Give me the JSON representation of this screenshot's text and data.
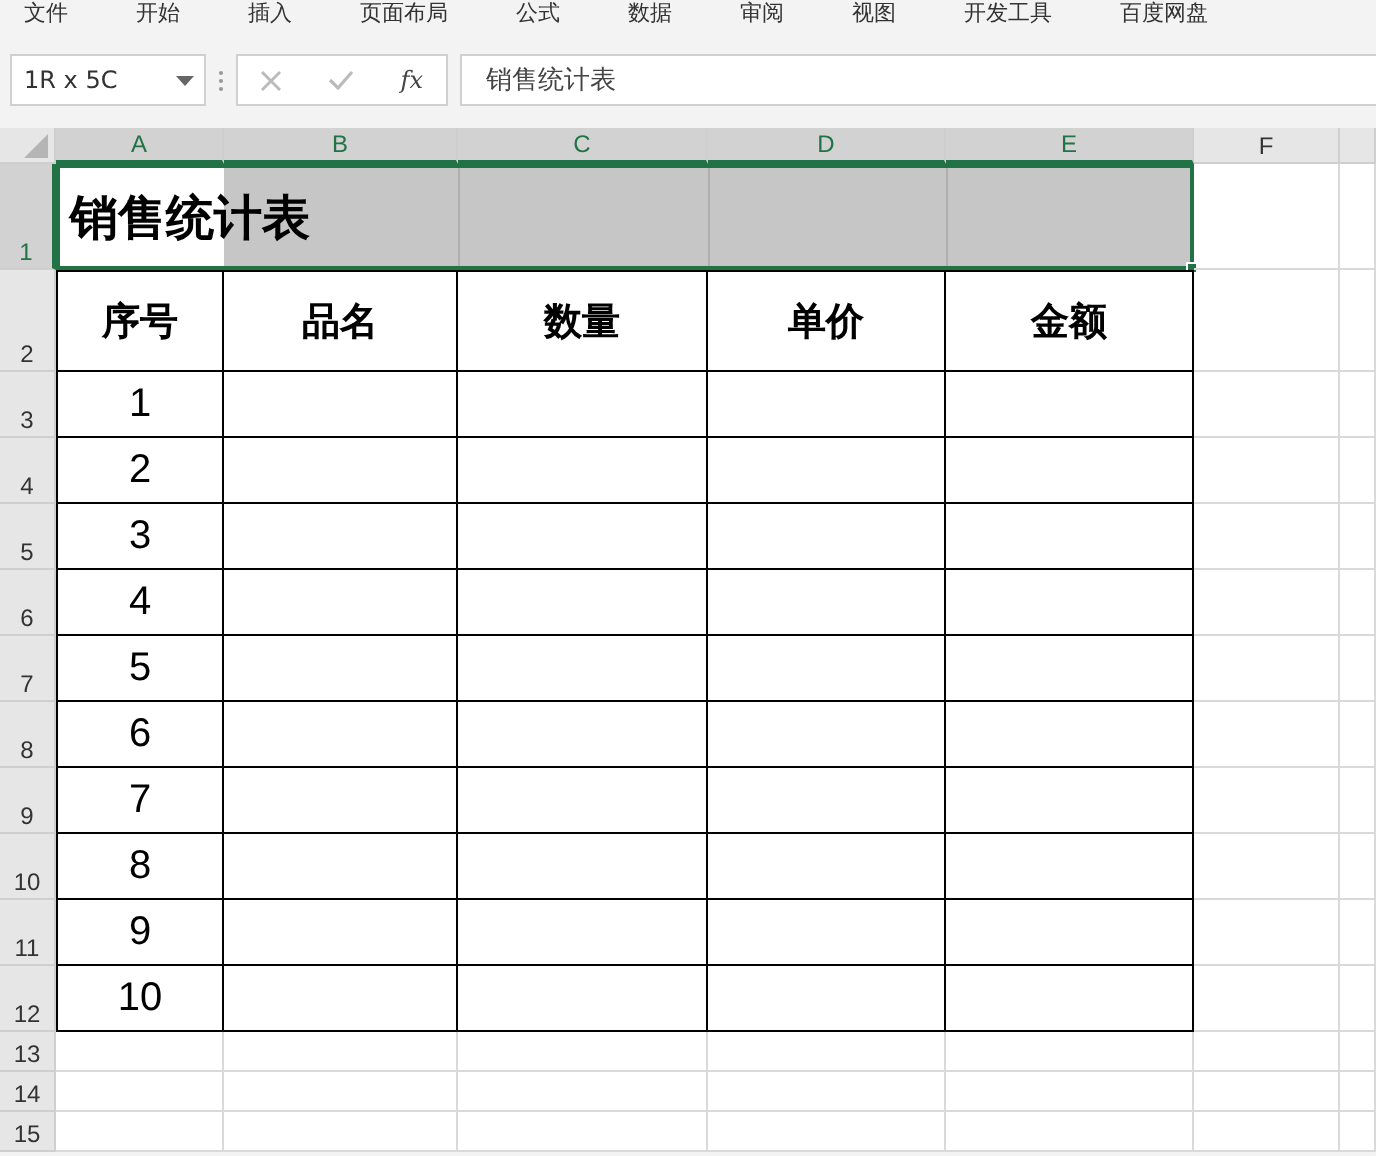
{
  "ribbon_tabs": [
    "文件",
    "开始",
    "插入",
    "页面布局",
    "公式",
    "数据",
    "审阅",
    "视图",
    "开发工具",
    "百度网盘"
  ],
  "name_box": "1R x 5C",
  "function_button": "fx",
  "formula": "销售统计表",
  "columns": [
    {
      "label": "A",
      "selected": true
    },
    {
      "label": "B",
      "selected": true
    },
    {
      "label": "C",
      "selected": true
    },
    {
      "label": "D",
      "selected": true
    },
    {
      "label": "E",
      "selected": true
    },
    {
      "label": "F",
      "selected": false
    }
  ],
  "row_headers": [
    {
      "label": "1",
      "selected": true
    },
    {
      "label": "2",
      "selected": false
    },
    {
      "label": "3",
      "selected": false
    },
    {
      "label": "4",
      "selected": false
    },
    {
      "label": "5",
      "selected": false
    },
    {
      "label": "6",
      "selected": false
    },
    {
      "label": "7",
      "selected": false
    },
    {
      "label": "8",
      "selected": false
    },
    {
      "label": "9",
      "selected": false
    },
    {
      "label": "10",
      "selected": false
    },
    {
      "label": "11",
      "selected": false
    },
    {
      "label": "12",
      "selected": false
    },
    {
      "label": "13",
      "selected": false
    },
    {
      "label": "14",
      "selected": false
    },
    {
      "label": "15",
      "selected": false
    }
  ],
  "table": {
    "title": "销售统计表",
    "headers": [
      "序号",
      "品名",
      "数量",
      "单价",
      "金额"
    ],
    "rows": [
      {
        "no": "1"
      },
      {
        "no": "2"
      },
      {
        "no": "3"
      },
      {
        "no": "4"
      },
      {
        "no": "5"
      },
      {
        "no": "6"
      },
      {
        "no": "7"
      },
      {
        "no": "8"
      },
      {
        "no": "9"
      },
      {
        "no": "10"
      }
    ]
  }
}
